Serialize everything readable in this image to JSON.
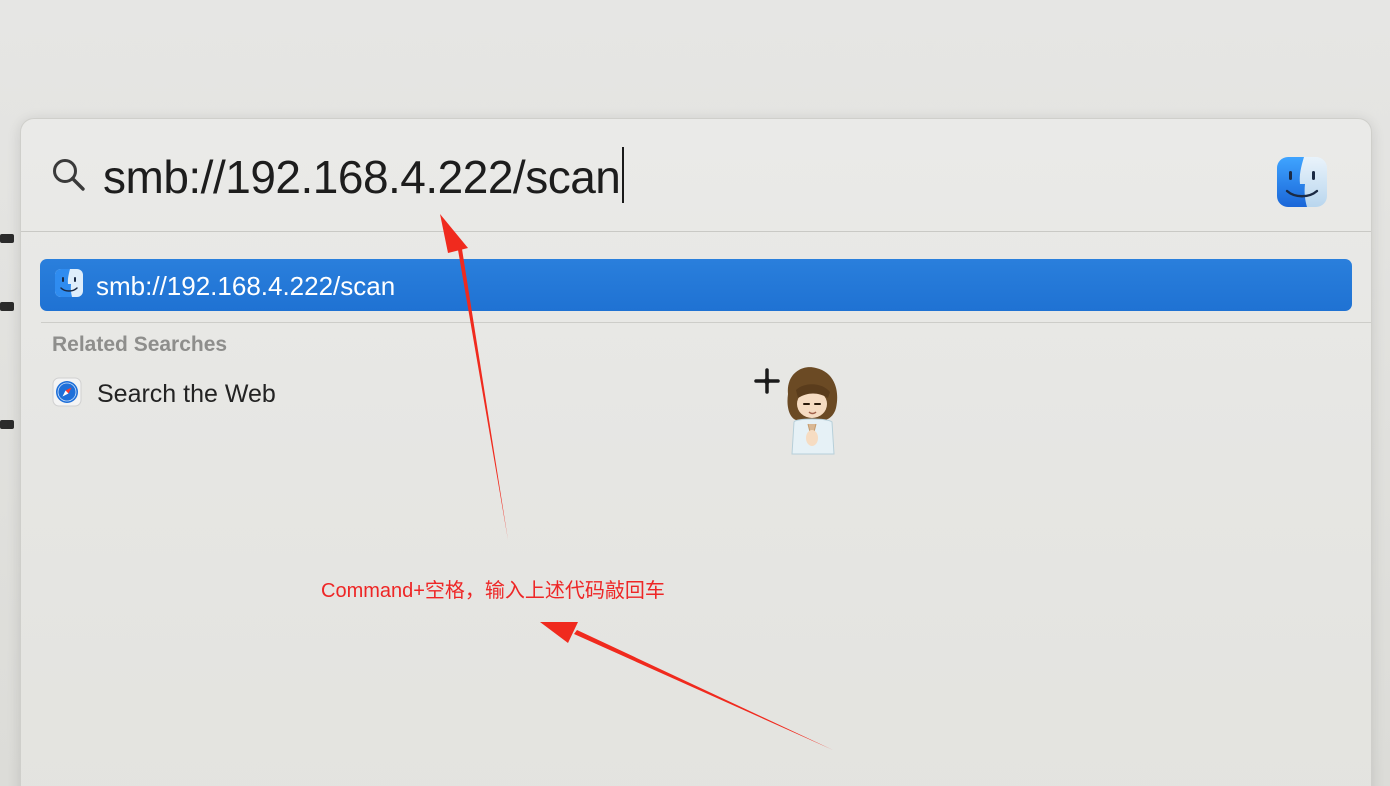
{
  "spotlight": {
    "query": "smb://192.168.4.222/scan",
    "app_icon": "finder-icon",
    "top_hit": {
      "label": "smb://192.168.4.222/scan",
      "icon": "finder-icon",
      "selected": true
    },
    "related_searches": {
      "header": "Related Searches",
      "items": [
        {
          "label": "Search the Web",
          "icon": "safari-icon"
        }
      ]
    }
  },
  "annotation": {
    "text": "Command+空格，输入上述代码敲回车",
    "color": "#ee2626"
  },
  "colors": {
    "selection": "#1f72d3",
    "panel_background": "#e6e6e3"
  }
}
